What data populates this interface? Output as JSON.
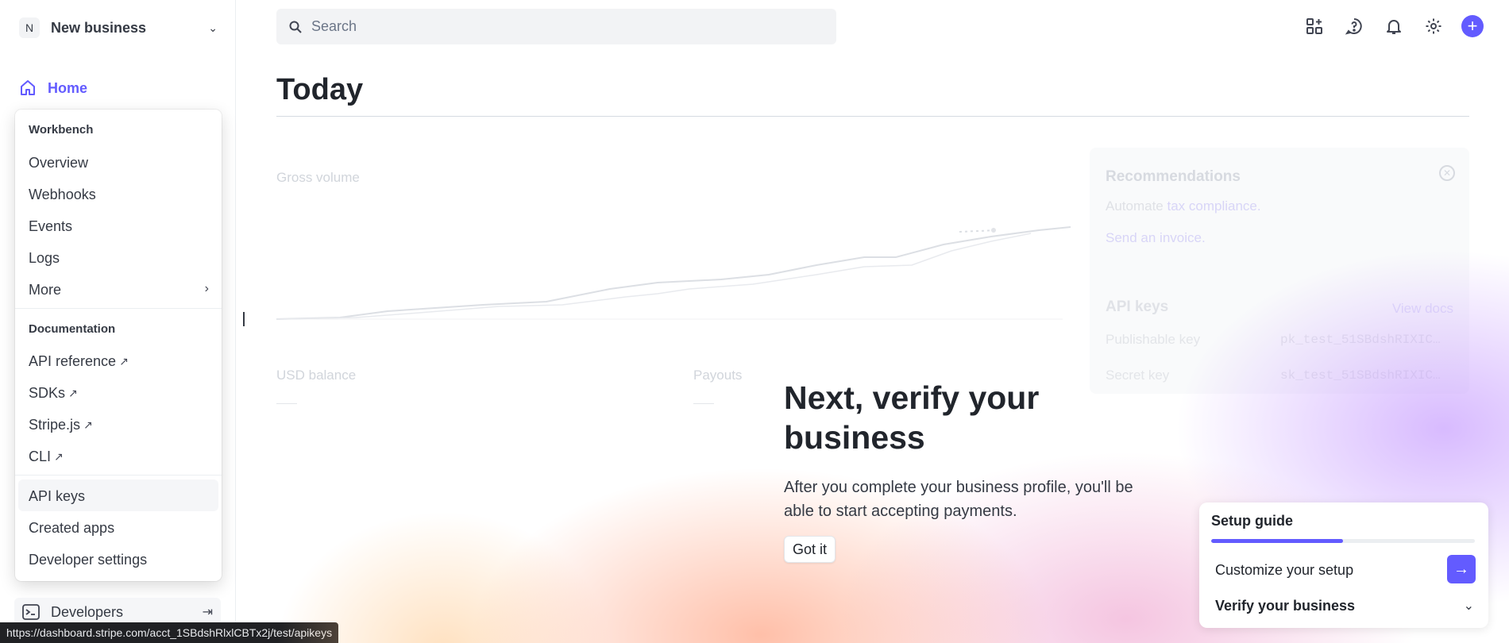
{
  "sidebar": {
    "business_initial": "N",
    "business_name": "New business",
    "home_label": "Home",
    "dropdown": {
      "workbench_heading": "Workbench",
      "workbench_items": [
        "Overview",
        "Webhooks",
        "Events",
        "Logs",
        "More"
      ],
      "docs_heading": "Documentation",
      "docs_items": [
        "API reference",
        "SDKs",
        "Stripe.js",
        "CLI"
      ],
      "bottom_items": [
        "API keys",
        "Created apps",
        "Developer settings"
      ]
    },
    "developers_label": "Developers"
  },
  "status_url": "https://dashboard.stripe.com/acct_1SBdshRlxlCBTx2j/test/apikeys",
  "header": {
    "search_placeholder": "Search"
  },
  "main": {
    "title": "Today",
    "gross_volume": "Gross volume",
    "usd_balance": "USD balance",
    "payouts": "Payouts",
    "recommendations": {
      "title": "Recommendations",
      "link1_prefix": "Automate",
      "link1_rest": "tax compliance.",
      "link2": "Send an invoice."
    },
    "api_keys": {
      "title": "API keys",
      "docs_link": "View docs",
      "publishable_label": "Publishable key",
      "publishable_value": "pk_test_51SBdshRIXIC…",
      "secret_label": "Secret key",
      "secret_value": "sk_test_51SBdshRIXIC…"
    }
  },
  "verify": {
    "heading": "Next, verify your business",
    "body": "After you complete your business profile, you'll be able to start accepting payments.",
    "button": "Got it"
  },
  "setup_guide": {
    "title": "Setup guide",
    "progress": 0.5,
    "step1": "Customize your setup",
    "step2": "Verify your business"
  },
  "colors": {
    "accent": "#635bff",
    "text": "#353a44"
  }
}
